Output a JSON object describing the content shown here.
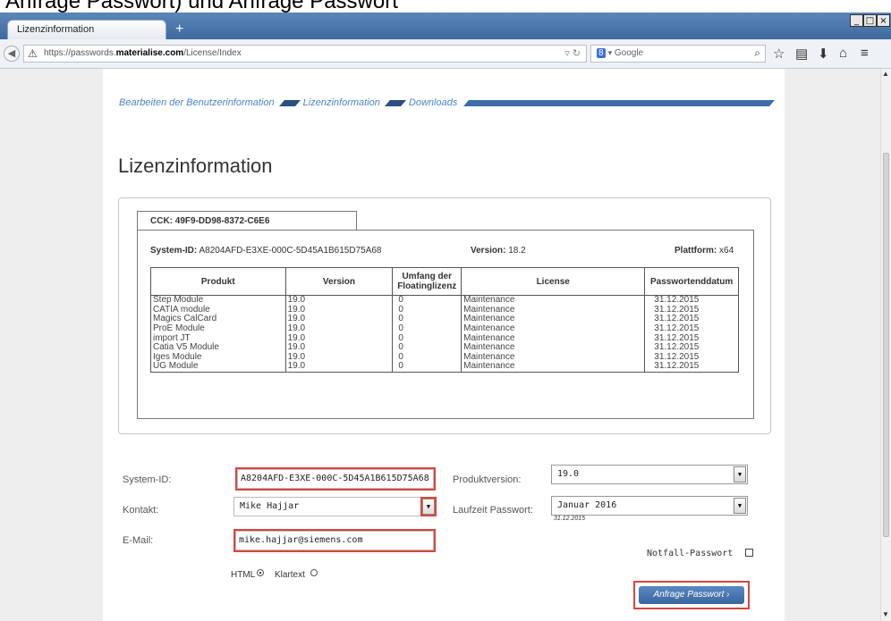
{
  "caption": {
    "text": "Anfrage Passwort) und Anfrage Passwort"
  },
  "browser": {
    "tab_title": "Lizenzinformation",
    "new_tab": "+",
    "url_prefix": "https://passwords.",
    "url_domain": "materialise.com",
    "url_path": "/License/Index",
    "search_placeholder": "Google",
    "window_controls": [
      "_",
      "□",
      "×"
    ],
    "icons": [
      "back-icon",
      "warning-icon",
      "reload-icon",
      "google-icon",
      "search-icon",
      "star-icon",
      "reading-list-icon",
      "download-icon",
      "home-icon",
      "menu-icon"
    ]
  },
  "breadcrumb": {
    "items": [
      "Bearbeiten der Benutzerinformation",
      "Lizenzinformation",
      "Downloads"
    ]
  },
  "page_title": "Lizenzinformation",
  "panel": {
    "cck_tab": "CCK: 49F9-DD98-8372-C6E6",
    "system_id_label": "System-ID:",
    "system_id_value": "A8204AFD-E3XE-000C-5D45A1B615D75A68",
    "version_label": "Version:",
    "version_value": "18.2",
    "platform_label": "Plattform:",
    "platform_value": "x64",
    "table": {
      "headers": [
        "Produkt",
        "Version",
        "Umfang der Floatinglizenz",
        "License",
        "Passwortenddatum"
      ],
      "rows": [
        [
          "Step Module",
          "19.0",
          "0",
          "Maintenance",
          "31.12.2015"
        ],
        [
          "CATIA module",
          "19.0",
          "0",
          "Maintenance",
          "31.12.2015"
        ],
        [
          "Magics CalCard",
          "19.0",
          "0",
          "Maintenance",
          "31.12.2015"
        ],
        [
          "ProE Module",
          "19.0",
          "0",
          "Maintenance",
          "31.12.2015"
        ],
        [
          "import JT",
          "19.0",
          "0",
          "Maintenance",
          "31.12.2015"
        ],
        [
          "Catia V5 Module",
          "19.0",
          "0",
          "Maintenance",
          "31.12.2015"
        ],
        [
          "Iges Module",
          "19.0",
          "0",
          "Maintenance",
          "31.12.2015"
        ],
        [
          "UG Module",
          "19.0",
          "0",
          "Maintenance",
          "31.12.2015"
        ]
      ]
    }
  },
  "form": {
    "system_id_label": "System-ID:",
    "system_id_value": "A8204AFD-E3XE-000C-5D45A1B615D75A68",
    "kontakt_label": "Kontakt:",
    "kontakt_value": "Mike Hajjar",
    "email_label": "E-Mail:",
    "email_value": "mike.hajjar@siemens.com",
    "produktversion_label": "Produktversion:",
    "produktversion_value": "19.0",
    "laufzeit_label": "Laufzeit Passwort:",
    "laufzeit_value": "Januar 2016",
    "laufzeit_date": "31.12.2015",
    "notfall_label": "Notfall-Passwort",
    "html_label": "HTML",
    "klartext_label": "Klartext",
    "format_selected": "HTML",
    "submit_label": "Anfrage Passwort ›"
  },
  "colors": {
    "accent": "#3d6ea8",
    "highlight": "#d9463e",
    "link": "#4a86c4"
  }
}
